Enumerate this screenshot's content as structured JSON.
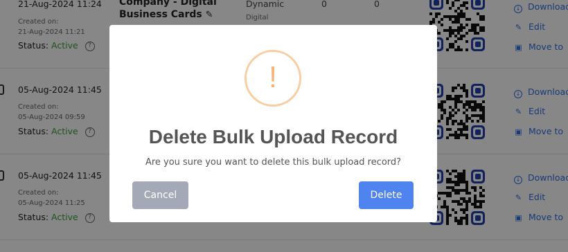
{
  "rows": [
    {
      "date": "21-Aug-2024 11:24",
      "created_label": "Created on:",
      "created_date": "21-Aug-2024 11:21",
      "status_label": "Status:",
      "status_value": "Active",
      "name_line1": "Company - Digital",
      "name_line2": "Business Cards",
      "type": "Dynamic",
      "subtype": "Digital",
      "count_a": "0",
      "count_b": "0",
      "actions": {
        "download": "Download",
        "edit": "Edit",
        "move": "Move to"
      }
    },
    {
      "date": "05-Aug-2024 11:45",
      "created_label": "Created on:",
      "created_date": "05-Aug-2024 09:59",
      "status_label": "Status:",
      "status_value": "Active",
      "actions": {
        "download": "Download",
        "edit": "Edit",
        "move": "Move to"
      }
    },
    {
      "date": "05-Aug-2024 11:45",
      "created_label": "Created on:",
      "created_date": "05-Aug-2024 11:25",
      "status_label": "Status:",
      "status_value": "Active",
      "actions": {
        "download": "Download",
        "edit": "Edit",
        "move": "Move to"
      }
    }
  ],
  "modal": {
    "icon_glyph": "!",
    "title": "Delete Bulk Upload Record",
    "message": "Are you sure you want to delete this bulk upload record?",
    "cancel_label": "Cancel",
    "delete_label": "Delete"
  },
  "colors": {
    "accent": "#4f83f0",
    "cancel": "#a3a9b7",
    "warning": "#f6b37a",
    "active": "#3a9d3a",
    "link": "#2f6fe0"
  }
}
